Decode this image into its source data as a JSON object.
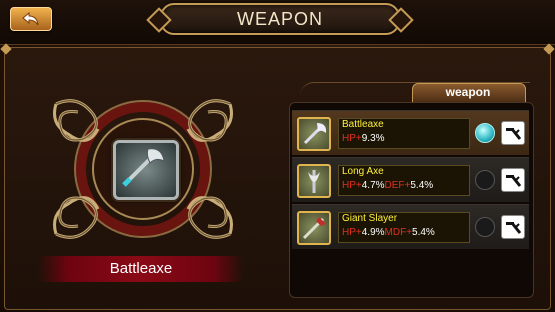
{
  "header": {
    "title": "WEAPON",
    "back_icon": "back-arrow-icon"
  },
  "emblem": {
    "icon": "battleaxe-icon"
  },
  "selected_weapon": {
    "name": "Battleaxe"
  },
  "tab": {
    "label": "weapon"
  },
  "weapons": [
    {
      "name": "Battleaxe",
      "stats": [
        {
          "label": "HP+",
          "value": "9.3%"
        }
      ],
      "selected": true,
      "upgrade_icon": "hammer-icon"
    },
    {
      "name": "Long Axe",
      "stats": [
        {
          "label": "HP+",
          "value": "4.7%"
        },
        {
          "label": "DEF+",
          "value": "5.4%"
        }
      ],
      "selected": false,
      "upgrade_icon": "hammer-icon"
    },
    {
      "name": "Giant Slayer",
      "stats": [
        {
          "label": "HP+",
          "value": "4.9%"
        },
        {
          "label": "MDF+",
          "value": "5.4%"
        }
      ],
      "selected": false,
      "upgrade_icon": "hammer-icon"
    }
  ],
  "colors": {
    "name_yellow": "#fff23a",
    "stat_red": "#e0301e",
    "accent_gold": "#c49a55",
    "banner_red": "#8a0a16",
    "selected_orb": "#2eb8c4"
  }
}
